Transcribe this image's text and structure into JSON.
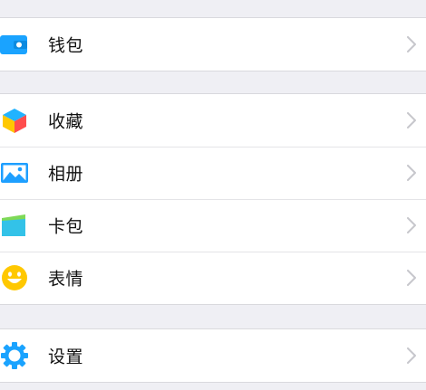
{
  "sections": [
    {
      "items": [
        {
          "label": "钱包",
          "icon": "wallet-icon",
          "color": "#1aa3ff"
        }
      ]
    },
    {
      "items": [
        {
          "label": "收藏",
          "icon": "favorites-cube-icon",
          "color": "#21b3ff"
        },
        {
          "label": "相册",
          "icon": "album-picture-icon",
          "color": "#1e9fff"
        },
        {
          "label": "卡包",
          "icon": "card-pack-icon",
          "color": "#33c2e8"
        },
        {
          "label": "表情",
          "icon": "smiley-face-icon",
          "color": "#ffc800"
        }
      ]
    },
    {
      "items": [
        {
          "label": "设置",
          "icon": "gear-icon",
          "color": "#1aa3ff"
        }
      ]
    }
  ],
  "colors": {
    "background": "#efeff4",
    "cell": "#ffffff",
    "separator": "#e4e4e7",
    "text": "#111111",
    "chevron": "#c7c7cc"
  }
}
